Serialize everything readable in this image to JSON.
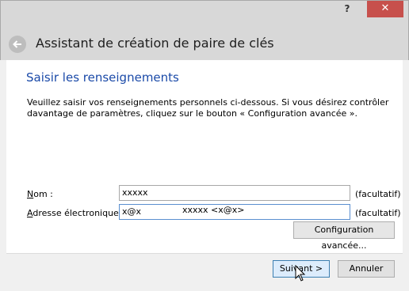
{
  "titlebar": {
    "help_label": "?",
    "close_label": "✕"
  },
  "wizard": {
    "title": "Assistant de création de paire de clés"
  },
  "page": {
    "section_title": "Saisir les renseignements",
    "description": "Veuillez saisir vos renseignements personnels ci-dessous. Si vous désirez contrôler davantage de paramètres, cliquez sur le bouton « Configuration avancée »."
  },
  "form": {
    "name_label": "Nom :",
    "name_value": "xxxxx",
    "name_optional": "(facultatif)",
    "email_label": "Adresse électronique :",
    "email_value": "x@x",
    "email_optional": "(facultatif)"
  },
  "summary": "xxxxx <x@x>",
  "buttons": {
    "advanced": "Configuration avancée...",
    "next": "Suivant >",
    "cancel": "Annuler"
  },
  "icons": {
    "back": "back-arrow-icon",
    "close": "close-icon",
    "help": "help-icon"
  }
}
